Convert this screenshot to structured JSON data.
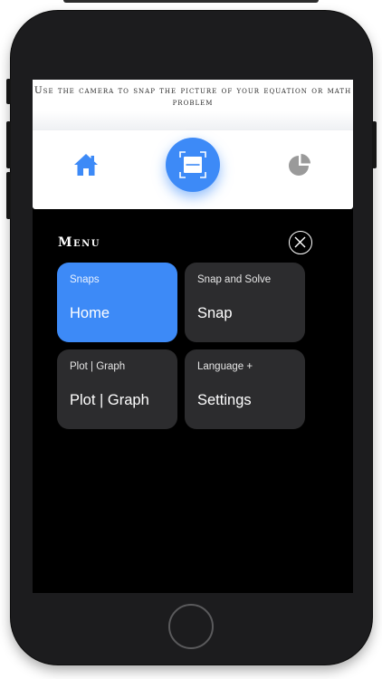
{
  "instruction": {
    "text": "Use the camera to snap the picture of your equation or math problem"
  },
  "nav": {
    "home_icon": "home-icon",
    "scan_icon": "scan-icon",
    "stats_icon": "pie-chart-icon",
    "accent_color": "#3d8af7",
    "inactive_color": "#9a9a9a"
  },
  "menu": {
    "title": "Menu",
    "close_icon": "close-icon",
    "tiles": [
      {
        "subtitle": "Snaps",
        "title": "Home",
        "active": true
      },
      {
        "subtitle": "Snap and Solve",
        "title": "Snap",
        "active": false
      },
      {
        "subtitle": "Plot | Graph",
        "title": "Plot | Graph",
        "active": false
      },
      {
        "subtitle": "Language +",
        "title": "Settings",
        "active": false
      }
    ]
  },
  "colors": {
    "tile_active": "#3d8af7",
    "tile_inactive": "#2c2c2e",
    "screen_bg": "#000000"
  }
}
